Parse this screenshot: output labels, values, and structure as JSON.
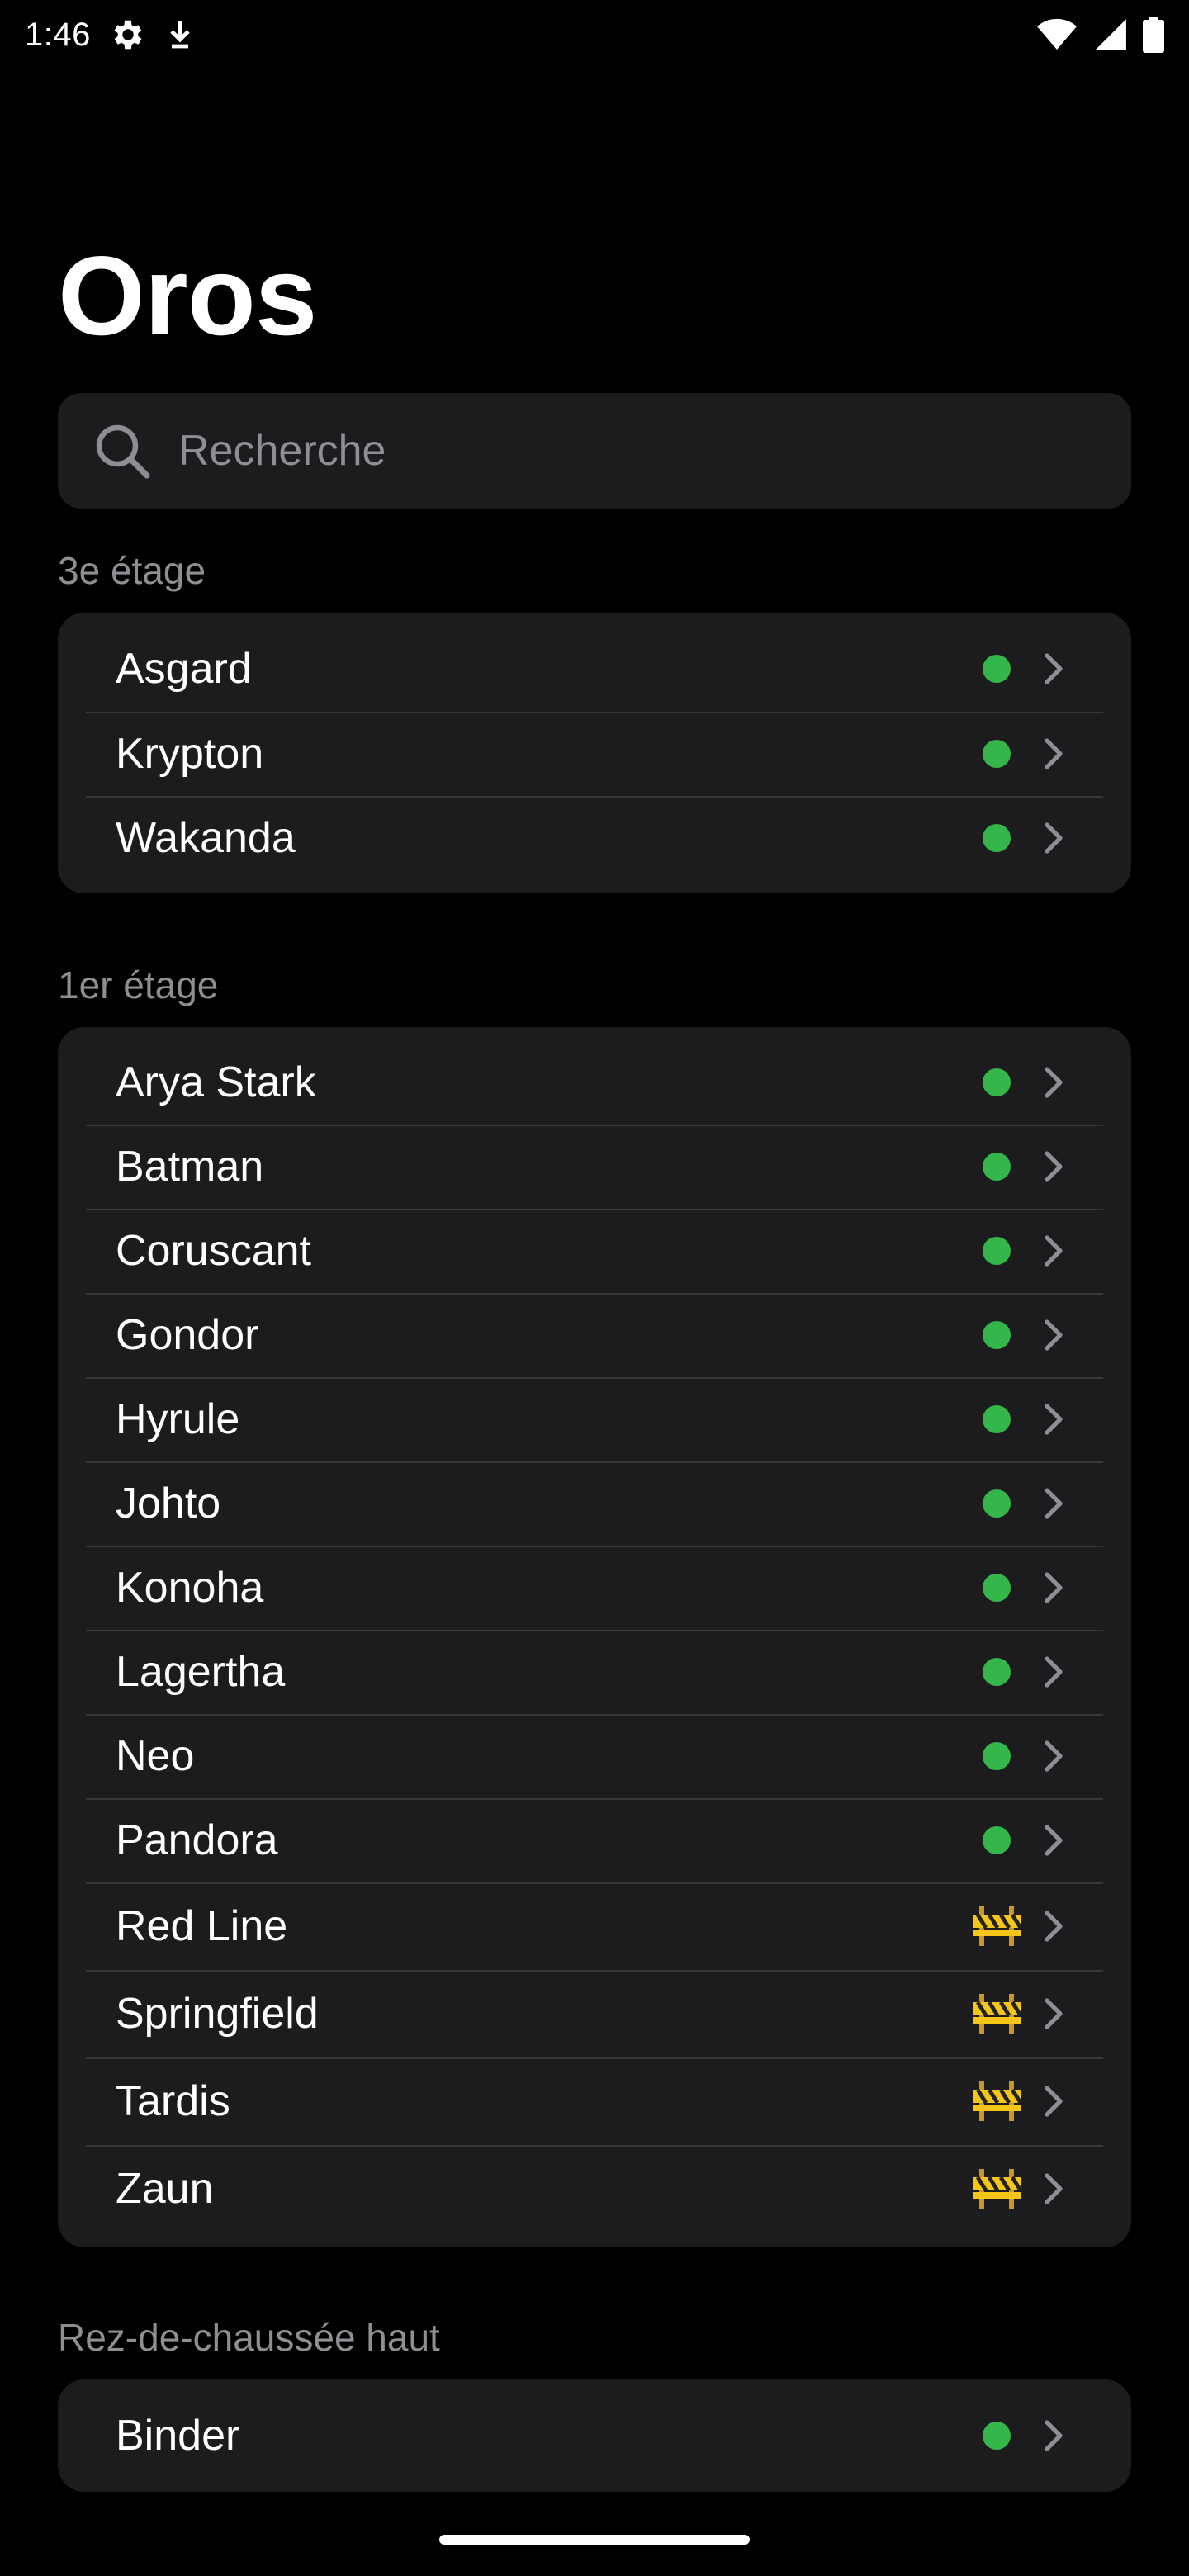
{
  "status_bar": {
    "time": "1:46",
    "icons": [
      "settings-icon",
      "download-icon",
      "wifi-icon",
      "signal-icon",
      "battery-icon"
    ]
  },
  "title": "Oros",
  "search": {
    "placeholder": "Recherche",
    "icon": "search-icon"
  },
  "colors": {
    "available": "#34b64a",
    "background": "#000000",
    "group_bg": "#1c1c1e",
    "secondary_text": "#8e8e93"
  },
  "sections": [
    {
      "header": "3e étage",
      "rooms": [
        {
          "name": "Asgard",
          "status": "available"
        },
        {
          "name": "Krypton",
          "status": "available"
        },
        {
          "name": "Wakanda",
          "status": "available"
        }
      ]
    },
    {
      "header": "1er étage",
      "rooms": [
        {
          "name": "Arya Stark",
          "status": "available"
        },
        {
          "name": "Batman",
          "status": "available"
        },
        {
          "name": "Coruscant",
          "status": "available"
        },
        {
          "name": "Gondor",
          "status": "available"
        },
        {
          "name": "Hyrule",
          "status": "available"
        },
        {
          "name": "Johto",
          "status": "available"
        },
        {
          "name": "Konoha",
          "status": "available"
        },
        {
          "name": "Lagertha",
          "status": "available"
        },
        {
          "name": "Neo",
          "status": "available"
        },
        {
          "name": "Pandora",
          "status": "available"
        },
        {
          "name": "Red Line",
          "status": "under-construction"
        },
        {
          "name": "Springfield",
          "status": "under-construction"
        },
        {
          "name": "Tardis",
          "status": "under-construction"
        },
        {
          "name": "Zaun",
          "status": "under-construction"
        }
      ]
    },
    {
      "header": "Rez-de-chaussée haut",
      "rooms": [
        {
          "name": "Binder",
          "status": "available"
        }
      ]
    }
  ]
}
